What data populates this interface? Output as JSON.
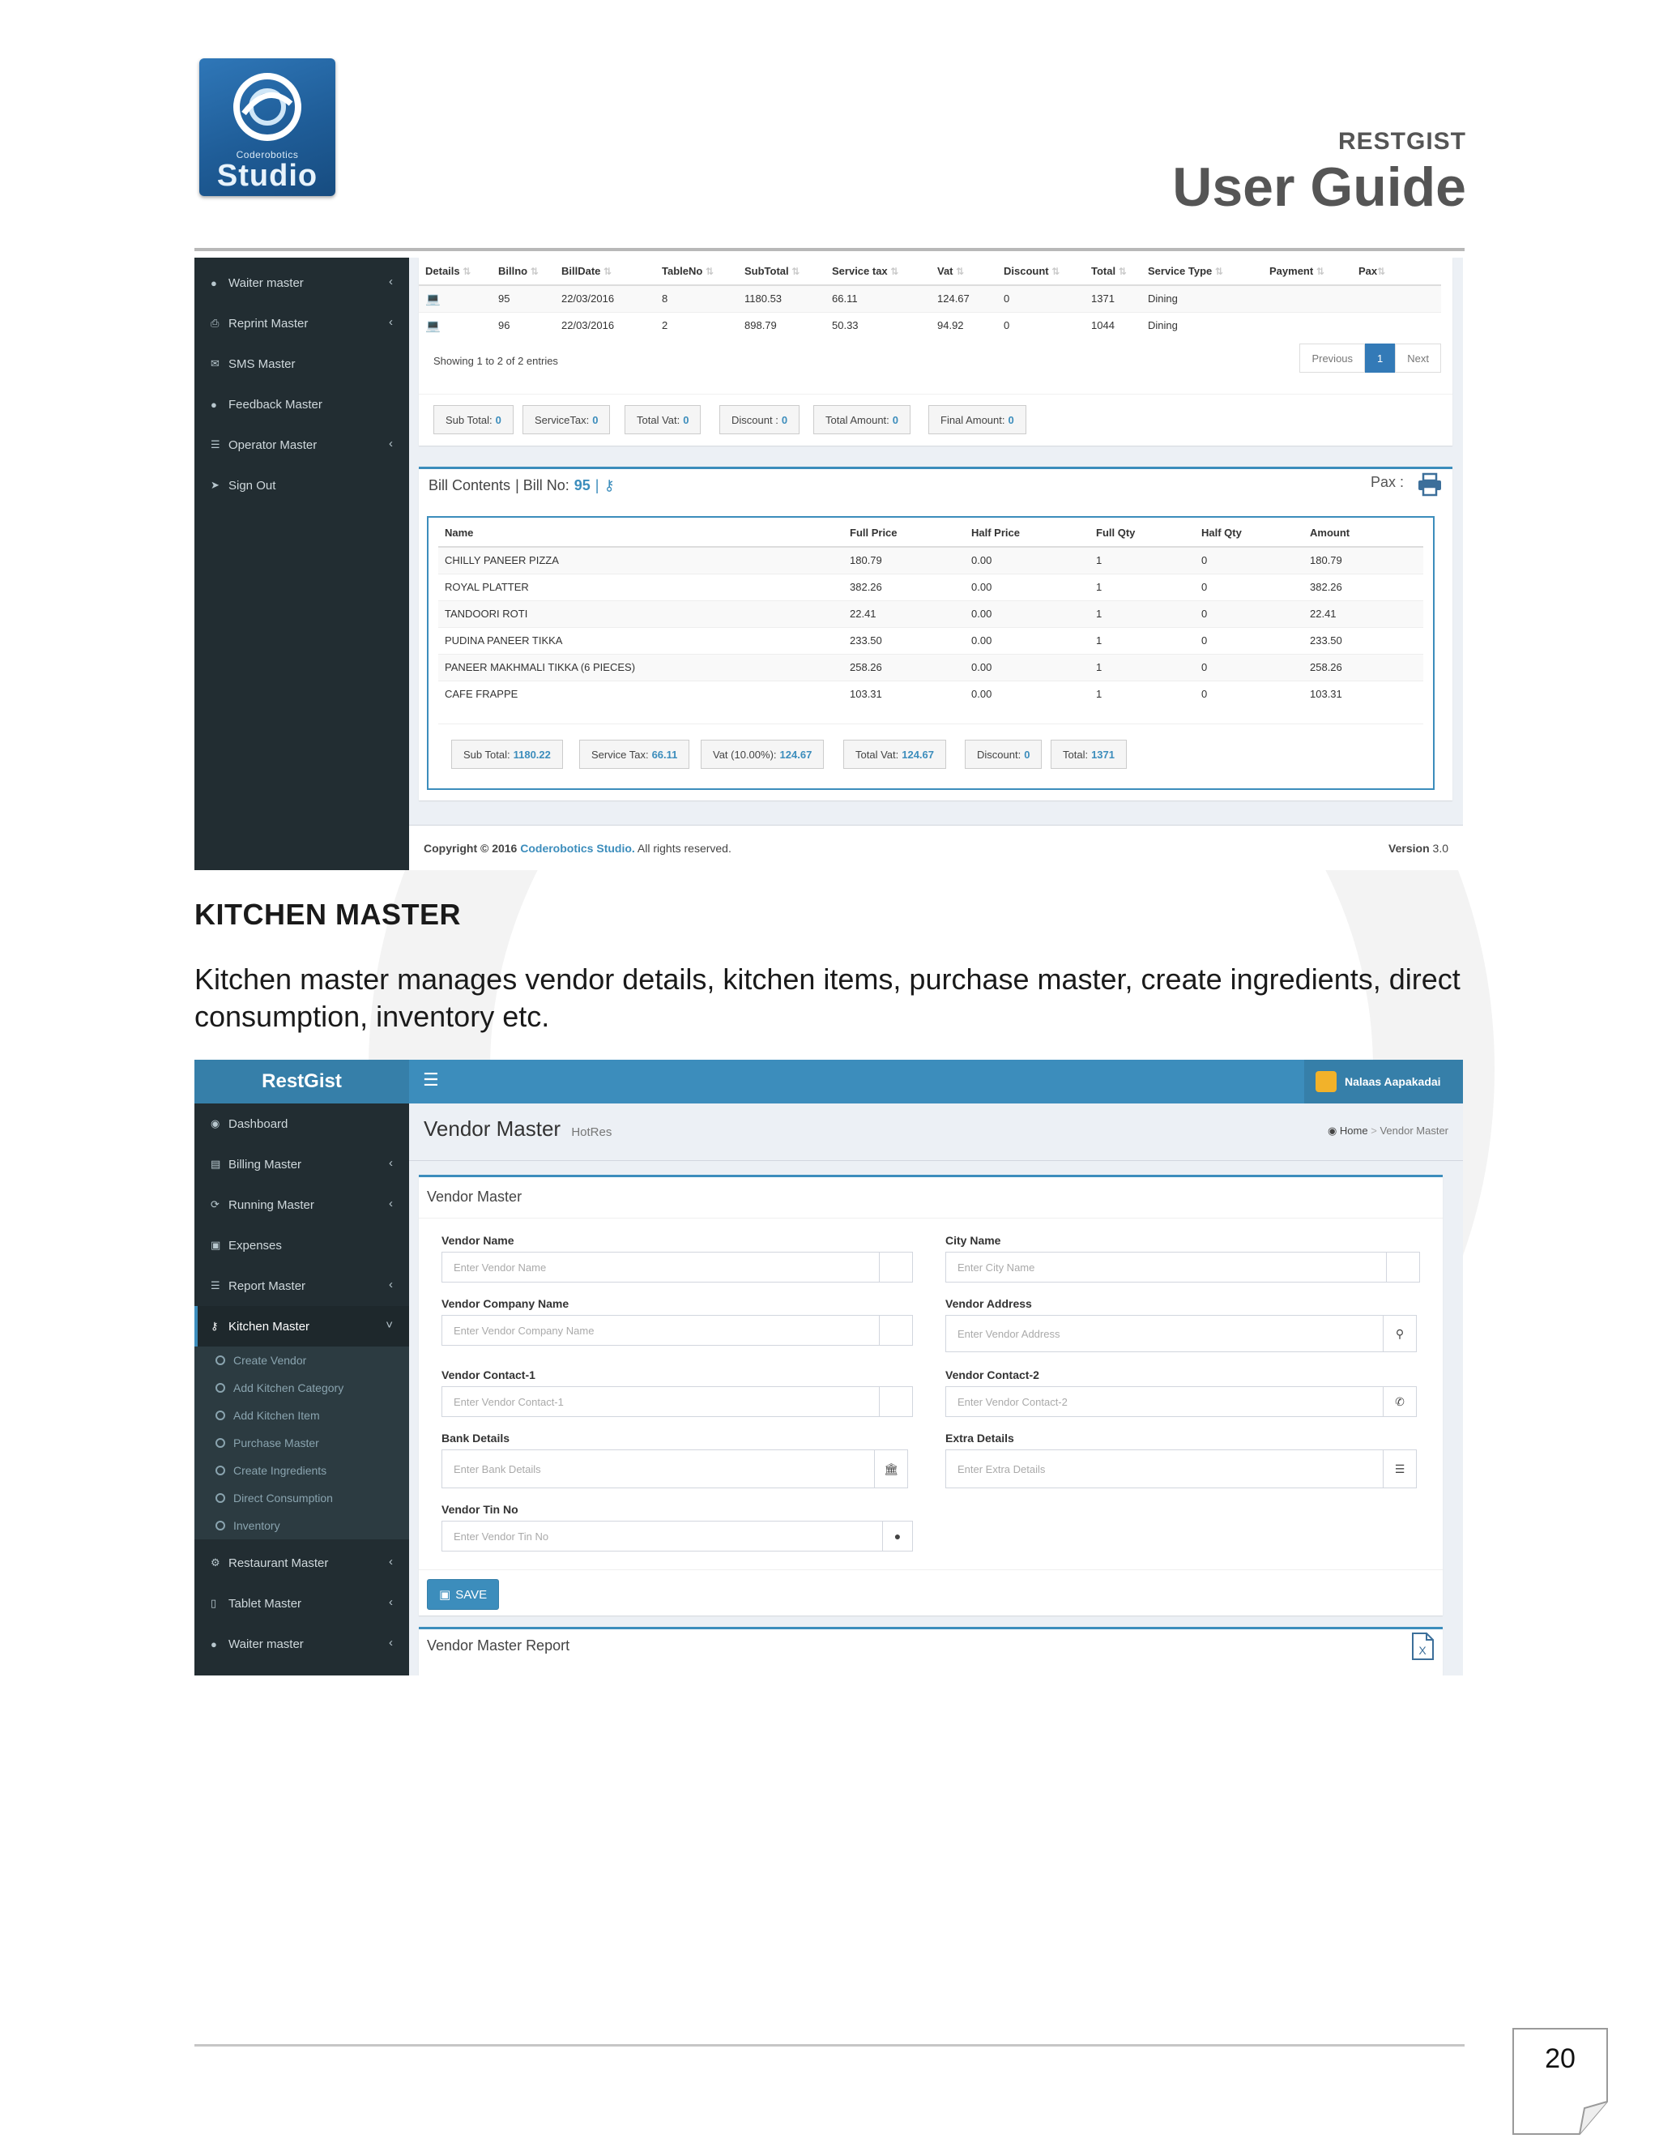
{
  "header": {
    "logo_small": "Coderobotics",
    "logo_main": "Studio",
    "brand": "RESTGIST",
    "title": "User Guide"
  },
  "shot1": {
    "sidebar": [
      {
        "label": "Waiter master",
        "icon": "user-icon",
        "chevron": true
      },
      {
        "label": "Reprint Master",
        "icon": "printer-icon",
        "chevron": true
      },
      {
        "label": "SMS Master",
        "icon": "envelope-icon",
        "chevron": false
      },
      {
        "label": "Feedback Master",
        "icon": "user-icon",
        "chevron": false
      },
      {
        "label": "Operator Master",
        "icon": "list-icon",
        "chevron": true
      },
      {
        "label": "Sign Out",
        "icon": "signout-icon",
        "chevron": false
      }
    ],
    "bills": {
      "columns": [
        "Details",
        "Billno",
        "BillDate",
        "TableNo",
        "SubTotal",
        "Service tax",
        "Vat",
        "Discount",
        "Total",
        "Service Type",
        "Payment",
        "Pax"
      ],
      "rows": [
        [
          "95",
          "22/03/2016",
          "8",
          "1180.53",
          "66.11",
          "124.67",
          "0",
          "1371",
          "Dining",
          "",
          ""
        ],
        [
          "96",
          "22/03/2016",
          "2",
          "898.79",
          "50.33",
          "94.92",
          "0",
          "1044",
          "Dining",
          "",
          ""
        ]
      ],
      "showing": "Showing 1 to 2 of 2 entries",
      "pager": {
        "previous": "Previous",
        "current": "1",
        "next": "Next"
      },
      "totals": [
        {
          "label": "Sub Total:",
          "value": "0"
        },
        {
          "label": "ServiceTax:",
          "value": "0"
        },
        {
          "label": "Total Vat:",
          "value": "0"
        },
        {
          "label": "Discount :",
          "value": "0"
        },
        {
          "label": "Total Amount:",
          "value": "0"
        },
        {
          "label": "Final Amount:",
          "value": "0"
        }
      ]
    },
    "bill_contents": {
      "title": "Bill Contents",
      "bill_label": "| Bill No:",
      "bill_no": "95",
      "pax_label": "Pax :",
      "columns": [
        "Name",
        "Full Price",
        "Half Price",
        "Full Qty",
        "Half Qty",
        "Amount"
      ],
      "rows": [
        [
          "CHILLY PANEER PIZZA",
          "180.79",
          "0.00",
          "1",
          "0",
          "180.79"
        ],
        [
          "ROYAL PLATTER",
          "382.26",
          "0.00",
          "1",
          "0",
          "382.26"
        ],
        [
          "TANDOORI ROTI",
          "22.41",
          "0.00",
          "1",
          "0",
          "22.41"
        ],
        [
          "PUDINA PANEER TIKKA",
          "233.50",
          "0.00",
          "1",
          "0",
          "233.50"
        ],
        [
          "PANEER MAKHMALI TIKKA (6 PIECES)",
          "258.26",
          "0.00",
          "1",
          "0",
          "258.26"
        ],
        [
          "CAFE FRAPPE",
          "103.31",
          "0.00",
          "1",
          "0",
          "103.31"
        ]
      ],
      "totals": [
        {
          "label": "Sub Total:",
          "value": "1180.22"
        },
        {
          "label": "Service Tax:",
          "value": "66.11"
        },
        {
          "label": "Vat (10.00%):",
          "value": "124.67"
        },
        {
          "label": "Total Vat:",
          "value": "124.67"
        },
        {
          "label": "Discount:",
          "value": "0"
        },
        {
          "label": "Total:",
          "value": "1371"
        }
      ]
    },
    "footer": {
      "copyright": "Copyright © 2016",
      "company": "Coderobotics Studio.",
      "rights": "All rights reserved.",
      "version_label": "Version",
      "version": "3.0"
    }
  },
  "section": {
    "title": "KITCHEN MASTER",
    "text": "Kitchen master manages vendor details, kitchen items, purchase master, create ingredients, direct consumption, inventory etc."
  },
  "shot2": {
    "app_name": "RestGist",
    "user_name": "Nalaas Aapakadai",
    "sidebar": [
      {
        "label": "Dashboard",
        "icon": "dashboard-icon",
        "chevron": false
      },
      {
        "label": "Billing Master",
        "icon": "billing-icon",
        "chevron": true
      },
      {
        "label": "Running Master",
        "icon": "refresh-icon",
        "chevron": true
      },
      {
        "label": "Expenses",
        "icon": "money-icon",
        "chevron": false
      },
      {
        "label": "Report Master",
        "icon": "list-icon",
        "chevron": true
      },
      {
        "label": "Kitchen Master",
        "icon": "cutlery-icon",
        "chevron": true
      }
    ],
    "submenu": [
      "Create Vendor",
      "Add Kitchen Category",
      "Add Kitchen Item",
      "Purchase Master",
      "Create Ingredients",
      "Direct Consumption",
      "Inventory"
    ],
    "sidebar_bottom": [
      {
        "label": "Restaurant Master",
        "icon": "cogs-icon",
        "chevron": true
      },
      {
        "label": "Tablet Master",
        "icon": "tablet-icon",
        "chevron": true
      },
      {
        "label": "Waiter master",
        "icon": "user-icon",
        "chevron": true
      }
    ],
    "page_title": "Vendor Master",
    "page_subtitle": "HotRes",
    "breadcrumb": {
      "home": "Home",
      "current": "Vendor Master"
    },
    "form_title": "Vendor Master",
    "fields": {
      "vendor_name": {
        "label": "Vendor Name",
        "placeholder": "Enter Vendor Name"
      },
      "city_name": {
        "label": "City Name",
        "placeholder": "Enter City Name"
      },
      "company_name": {
        "label": "Vendor Company Name",
        "placeholder": "Enter Vendor Company Name"
      },
      "address": {
        "label": "Vendor Address",
        "placeholder": "Enter Vendor Address"
      },
      "contact1": {
        "label": "Vendor Contact-1",
        "placeholder": "Enter Vendor Contact-1"
      },
      "contact2": {
        "label": "Vendor Contact-2",
        "placeholder": "Enter Vendor Contact-2"
      },
      "bank": {
        "label": "Bank Details",
        "placeholder": "Enter Bank Details"
      },
      "extra": {
        "label": "Extra Details",
        "placeholder": "Enter Extra Details"
      },
      "tin": {
        "label": "Vendor Tin No",
        "placeholder": "Enter Vendor Tin No"
      }
    },
    "save_label": "SAVE",
    "report_title": "Vendor Master Report"
  },
  "page_number": "20"
}
